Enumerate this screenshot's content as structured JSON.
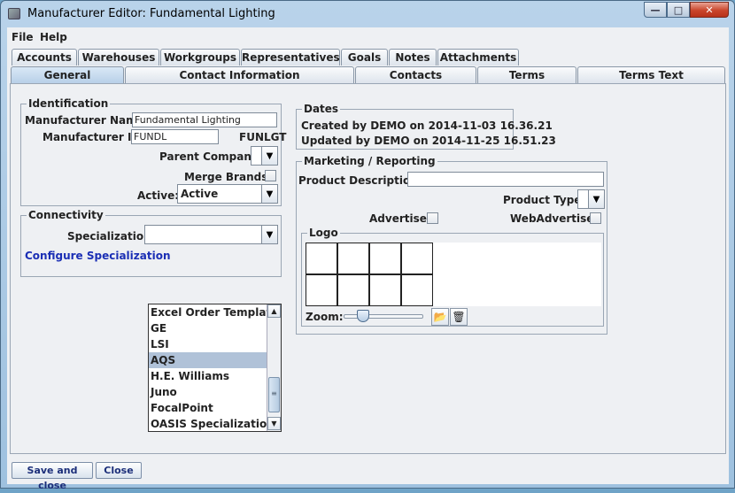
{
  "window": {
    "title": "Manufacturer Editor: Fundamental Lighting"
  },
  "menu": {
    "file": "File",
    "help": "Help"
  },
  "tabs_row1": [
    "Accounts",
    "Warehouses",
    "Workgroups",
    "Representatives",
    "Goals",
    "Notes",
    "Attachments"
  ],
  "tabs_row2": [
    "General",
    "Contact Information",
    "Contacts",
    "Terms",
    "Terms Text"
  ],
  "selected_tab": "General",
  "identification": {
    "legend": "Identification",
    "name_label": "Manufacturer Name:",
    "name_value": "Fundamental Lighting",
    "id_label": "Manufacturer ID:",
    "id_value": "FUNDL",
    "id_code": "FUNLGT",
    "parent_label": "Parent Company:",
    "parent_value": "",
    "merge_label": "Merge Brands:",
    "merge_checked": false,
    "active_label": "Active:",
    "active_value": "Active"
  },
  "connectivity": {
    "legend": "Connectivity",
    "spec_label": "Specialization:",
    "spec_value": "",
    "configure_link": "Configure Specialization",
    "options": [
      "Excel Order Template",
      "GE",
      "LSI",
      "AQS",
      "H.E. Williams",
      "Juno",
      "FocalPoint",
      "OASIS Specialization"
    ],
    "highlighted_option": "AQS"
  },
  "dates": {
    "legend": "Dates",
    "created": "Created by DEMO on 2014-11-03 16.36.21",
    "updated": "Updated by DEMO on 2014-11-25 16.51.23"
  },
  "marketing": {
    "legend": "Marketing / Reporting",
    "desc_label": "Product Description:",
    "desc_value": "",
    "type_label": "Product Type:",
    "type_value": "",
    "advertise_label": "Advertise:",
    "advertise_checked": false,
    "webadvertise_label": "WebAdvertise:",
    "webadvertise_checked": false
  },
  "logo": {
    "legend": "Logo",
    "zoom_label": "Zoom:",
    "zoom_level": 0.2
  },
  "buttons": {
    "save_close": "Save and close",
    "close": "Close"
  },
  "icons": {
    "app": "app-icon",
    "minimize": "minimize-icon",
    "maximize": "maximize-icon",
    "close": "close-icon",
    "dropdown": "chevron-down-icon",
    "open_image": "folder-open-icon",
    "delete": "trash-icon"
  }
}
